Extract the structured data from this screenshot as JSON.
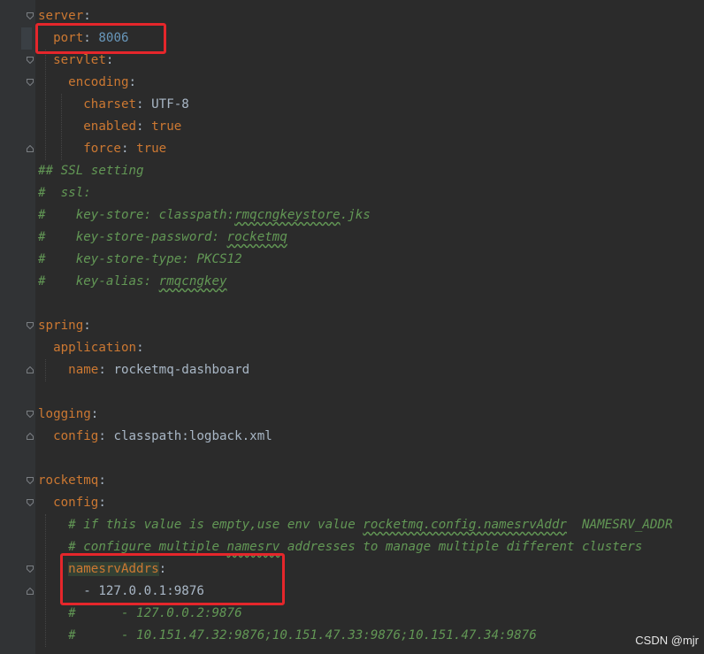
{
  "editor": {
    "lines": [
      {
        "key": "server",
        "sep": ":"
      },
      {
        "indent": "  ",
        "key": "port",
        "sep": ": ",
        "num": "8006"
      },
      {
        "indent": "  ",
        "key": "servlet",
        "sep": ":"
      },
      {
        "indent": "    ",
        "key": "encoding",
        "sep": ":"
      },
      {
        "indent": "      ",
        "key": "charset",
        "sep": ": ",
        "val": "UTF-8"
      },
      {
        "indent": "      ",
        "key": "enabled",
        "sep": ": ",
        "kw": "true"
      },
      {
        "indent": "      ",
        "key": "force",
        "sep": ": ",
        "kw": "true"
      },
      {
        "comment": "## SSL setting"
      },
      {
        "comment": "#  ssl:"
      },
      {
        "comment": "#    key-store: classpath:",
        "comment_u": "rmqcngkeystore",
        "comment_tail": ".jks"
      },
      {
        "comment": "#    key-store-password: ",
        "comment_u": "rocketmq",
        "comment_tail": ""
      },
      {
        "comment": "#    key-store-type: PKCS12"
      },
      {
        "comment": "#    key-alias: ",
        "comment_u": "rmqcngkey",
        "comment_tail": ""
      },
      {},
      {
        "key": "spring",
        "sep": ":"
      },
      {
        "indent": "  ",
        "key": "application",
        "sep": ":"
      },
      {
        "indent": "    ",
        "key": "name",
        "sep": ": ",
        "val": "rocketmq-dashboard"
      },
      {},
      {
        "key": "logging",
        "sep": ":"
      },
      {
        "indent": "  ",
        "key": "config",
        "sep": ": ",
        "val": "classpath:logback.xml"
      },
      {},
      {
        "key": "rocketmq",
        "sep": ":"
      },
      {
        "indent": "  ",
        "key": "config",
        "sep": ":"
      },
      {
        "indent": "    ",
        "comment": "# if this value is empty,use env value ",
        "comment_u": "rocketmq.config.namesrvAddr",
        "comment_tail": "  NAMESRV_ADDR"
      },
      {
        "indent": "    ",
        "comment": "# configure multiple ",
        "comment_u": "namesrv",
        "comment_tail": " addresses to manage multiple different clusters"
      },
      {
        "indent": "    ",
        "key": "namesrvAddrs",
        "sep": ":",
        "highlight": true
      },
      {
        "indent": "      ",
        "val": "- 127.0.0.1:9876"
      },
      {
        "indent": "    ",
        "comment": "#      - 127.0.0.2:9876"
      },
      {
        "indent": "    ",
        "comment": "#      - 10.151.47.32:9876;10.151.47.33:9876;10.151.47.34:9876"
      }
    ]
  },
  "watermark": "CSDN @mjr",
  "colors": {
    "key": "#cc7832",
    "number": "#6897bb",
    "comment": "#629755",
    "text": "#a9b7c6",
    "annotation": "#e5262b"
  }
}
